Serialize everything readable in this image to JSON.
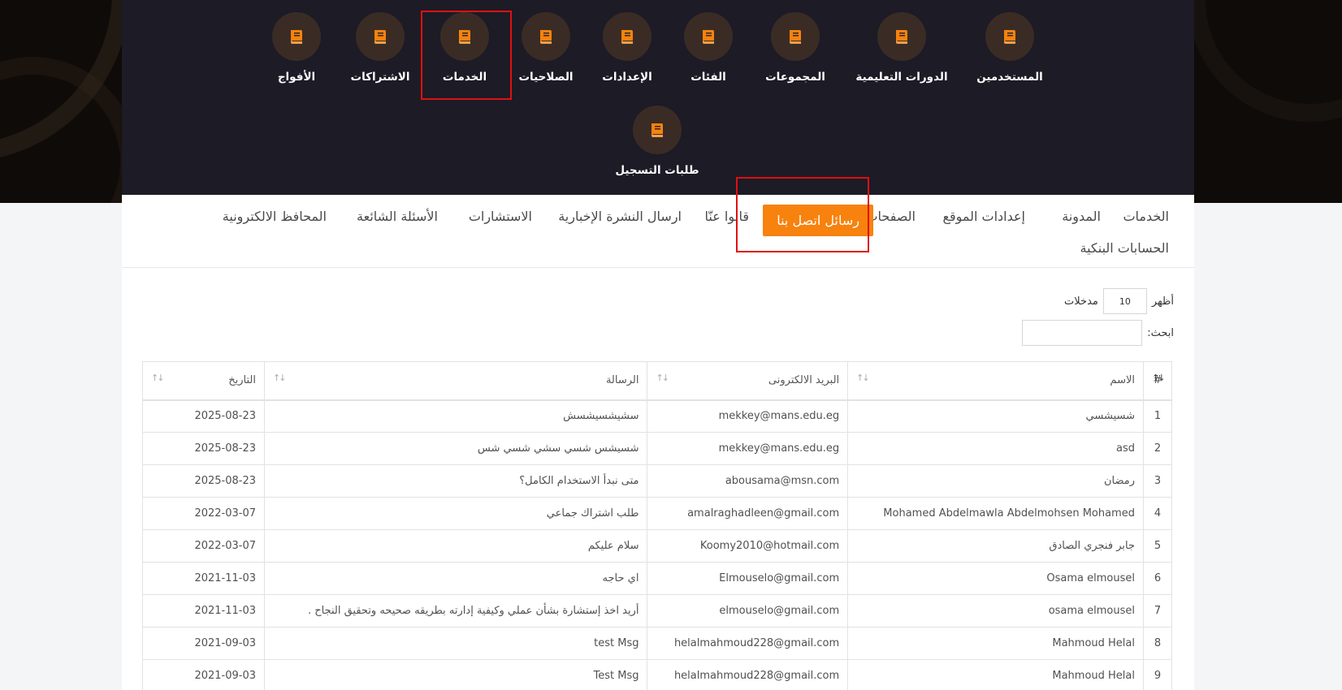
{
  "top_nav": {
    "items": [
      {
        "label": "المستخدمين",
        "icon": "book-icon"
      },
      {
        "label": "الدورات التعليمية",
        "icon": "book-icon"
      },
      {
        "label": "المجموعات",
        "icon": "book-icon"
      },
      {
        "label": "الفئات",
        "icon": "book-icon"
      },
      {
        "label": "الإعدادات",
        "icon": "book-icon"
      },
      {
        "label": "الصلاحيات",
        "icon": "book-icon"
      },
      {
        "label": "الخدمات",
        "icon": "book-icon"
      },
      {
        "label": "الاشتراكات",
        "icon": "book-icon"
      },
      {
        "label": "الأفواج",
        "icon": "book-icon"
      },
      {
        "label": "طلبات التسجيل",
        "icon": "book-icon"
      }
    ],
    "highlighted": "الخدمات"
  },
  "tabs": {
    "items": [
      "الخدمات",
      "المدونة",
      "إعدادات الموقع",
      "الصفحات",
      "رسائل اتصل بنا",
      "قالوا عنّا",
      "ارسال النشرة الإخبارية",
      "الاستشارات",
      "الأسئلة الشائعة",
      "المحافظ الالكترونية",
      "الحسابات البنكية"
    ],
    "active": "رسائل اتصل بنا"
  },
  "controls": {
    "show_label": "أظهر",
    "entries_value": "10",
    "entries_label": "مدخلات",
    "search_label": "ابحث:",
    "search_value": ""
  },
  "table": {
    "headers": [
      "#",
      "الاسم",
      "البريد الالكترونى",
      "الرسالة",
      "التاريخ"
    ],
    "rows": [
      [
        "1",
        "شسيشسي",
        "mekkey@mans.edu.eg",
        "سشيشسيشسش",
        "2025-08-23"
      ],
      [
        "2",
        "asd",
        "mekkey@mans.edu.eg",
        "شسيشس شسي سشي شسي شس",
        "2025-08-23"
      ],
      [
        "3",
        "رمضان",
        "abousama@msn.com",
        "متى نبدأ الاستخدام الكامل؟",
        "2025-08-23"
      ],
      [
        "4",
        "Mohamed Abdelmawla Abdelmohsen Mohamed",
        "amalraghadleen@gmail.com",
        "طلب اشتراك جماعي",
        "2022-03-07"
      ],
      [
        "5",
        "جابر فنجري الصادق",
        "Koomy2010@hotmail.com",
        "سلام عليكم",
        "2022-03-07"
      ],
      [
        "6",
        "Osama elmousel",
        "Elmouselo@gmail.com",
        "اي حاجه",
        "2021-11-03"
      ],
      [
        "7",
        "osama elmousel",
        "elmouselo@gmail.com",
        "أريد اخذ إستشارة بشأن عملي وكيفية إدارته بطريقه صحيحه وتحقيق النجاح .",
        "2021-11-03"
      ],
      [
        "8",
        "Mahmoud Helal",
        "helalmahmoud228@gmail.com",
        "test Msg",
        "2021-09-03"
      ],
      [
        "9",
        "Mahmoud Helal",
        "helalmahmoud228@gmail.com",
        "Test Msg",
        "2021-09-03"
      ]
    ]
  },
  "colors": {
    "accent": "#f7820e",
    "panel": "#1c1b26",
    "highlight": "#e01010"
  }
}
